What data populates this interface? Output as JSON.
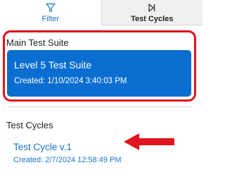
{
  "tabs": [
    {
      "label": "Filter",
      "icon": "filter-icon"
    },
    {
      "label": "Test Cycles",
      "icon": "skip-forward-icon"
    }
  ],
  "main_suite": {
    "section_title": "Main Test Suite",
    "name": "Level 5 Test Suite",
    "created": "Created: 1/10/2024 3:40:03 PM"
  },
  "test_cycles": {
    "section_title": "Test Cycles",
    "items": [
      {
        "name": "Test Cycle v.1",
        "created": "Created: 2/7/2024 12:58:49 PM"
      }
    ]
  },
  "colors": {
    "accent_blue": "#0a6ed1",
    "link_blue": "#1a73c8",
    "highlight_red": "#e0141e"
  }
}
